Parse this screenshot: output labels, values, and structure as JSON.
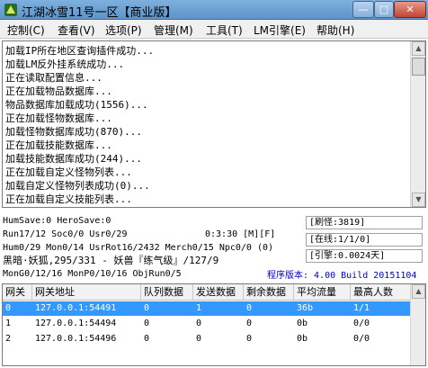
{
  "window": {
    "title": "江湖冰雪11号一区【商业版】",
    "minimize": "—",
    "maximize": "□",
    "close": "✕"
  },
  "menu": [
    {
      "label": "控制(C)"
    },
    {
      "label": "查看(V)"
    },
    {
      "label": "选项(P)"
    },
    {
      "label": "管理(M)"
    },
    {
      "label": "工具(T)"
    },
    {
      "label": "LM引擎(E)"
    },
    {
      "label": "帮助(H)"
    }
  ],
  "log": [
    "加载IP所在地区查询插件成功...",
    "加载LM反外挂系统成功...",
    "正在读取配置信息...",
    "正在加载物品数据库...",
    "物品数据库加载成功(1556)...",
    "正在加载怪物数据库...",
    "加载怪物数据库成功(870)...",
    "正在加载技能数据库...",
    "加载技能数据库成功(244)...",
    "正在加载自定义怪物列表...",
    "加载自定义怪物列表成功(0)...",
    "正在加载自定义技能列表..."
  ],
  "status": {
    "save": "HumSave:0 HeroSave:0",
    "run": "Run17/12 Soc0/0 Usr0/29",
    "time": "0:3:30 [M][F]",
    "hum": "Hum0/29 Mon0/14 UsrRot16/2432 Merch0/15 Npc0/0 (0)",
    "map": "黑暗·妖狐,295/331 - 妖兽『练气级』/127/9",
    "mon": "MonG0/12/16 MonP0/10/16 ObjRun0/5",
    "refresh": "[刷怪:3819]",
    "online": "[在线:1/1/0]",
    "gate_rate": "[引擎:0.0024天]",
    "version": "程序版本: 4.00 Build 20151104"
  },
  "table": {
    "columns": [
      "网关",
      "网关地址",
      "队列数据",
      "发送数据",
      "剩余数据",
      "平均流量",
      "最高人数"
    ],
    "rows": [
      [
        "0",
        "127.0.0.1:54491",
        "0",
        "1",
        "0",
        "36b",
        "1/1"
      ],
      [
        "1",
        "127.0.0.1:54494",
        "0",
        "0",
        "0",
        "0b",
        "0/0"
      ],
      [
        "2",
        "127.0.0.1:54496",
        "0",
        "0",
        "0",
        "0b",
        "0/0"
      ]
    ],
    "selected_row": 0
  },
  "colors": {
    "selection": "#3399ff",
    "version_text": "#0000c8",
    "titlebar": "#6fa3d6"
  }
}
